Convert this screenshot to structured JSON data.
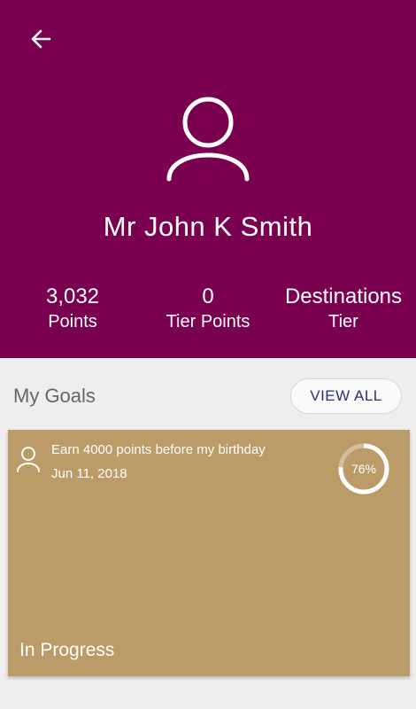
{
  "header": {
    "back_icon": "arrow-left-icon",
    "avatar_icon": "user-outline-icon",
    "name": "Mr John  K Smith",
    "bg_color": "#7a0050",
    "stats": [
      {
        "value": "3,032",
        "label": "Points"
      },
      {
        "value": "0",
        "label": "Tier Points"
      },
      {
        "value": "Destinations",
        "label": "Tier"
      }
    ]
  },
  "goals": {
    "title": "My Goals",
    "view_all_label": "VIEW ALL",
    "items": [
      {
        "icon": "user-outline-icon",
        "text": "Earn 4000 points before my birthday",
        "date": "Jun 11, 2018",
        "progress_label": "76%",
        "progress": 0.76,
        "status": "In Progress",
        "card_color": "#bb9b68"
      }
    ]
  }
}
